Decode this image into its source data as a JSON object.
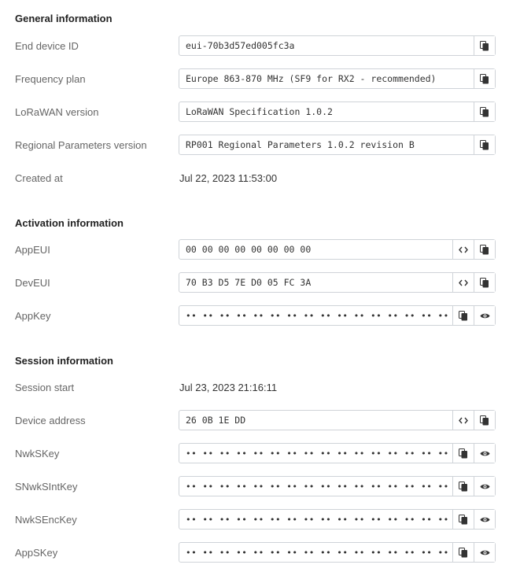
{
  "general": {
    "title": "General information",
    "end_device_id": {
      "label": "End device ID",
      "value": "eui-70b3d57ed005fc3a"
    },
    "frequency_plan": {
      "label": "Frequency plan",
      "value": "Europe 863-870 MHz (SF9 for RX2 - recommended)"
    },
    "lorawan_version": {
      "label": "LoRaWAN version",
      "value": "LoRaWAN Specification 1.0.2"
    },
    "regional_params": {
      "label": "Regional Parameters version",
      "value": "RP001 Regional Parameters 1.0.2 revision B"
    },
    "created_at": {
      "label": "Created at",
      "value": "Jul 22, 2023 11:53:00"
    }
  },
  "activation": {
    "title": "Activation information",
    "app_eui": {
      "label": "AppEUI",
      "value": "00 00 00 00 00 00 00 00"
    },
    "dev_eui": {
      "label": "DevEUI",
      "value": "70 B3 D5 7E D0 05 FC 3A"
    },
    "app_key": {
      "label": "AppKey",
      "value": "•• •• •• •• •• •• •• •• •• •• •• •• •• •• •• ••"
    }
  },
  "session": {
    "title": "Session information",
    "session_start": {
      "label": "Session start",
      "value": "Jul 23, 2023 21:16:11"
    },
    "device_address": {
      "label": "Device address",
      "value": "26 0B 1E DD"
    },
    "nwk_s_key": {
      "label": "NwkSKey",
      "value": "•• •• •• •• •• •• •• •• •• •• •• •• •• •• •• ••"
    },
    "s_nwk_s_int_key": {
      "label": "SNwkSIntKey",
      "value": "•• •• •• •• •• •• •• •• •• •• •• •• •• •• •• ••"
    },
    "nwk_s_enc_key": {
      "label": "NwkSEncKey",
      "value": "•• •• •• •• •• •• •• •• •• •• •• •• •• •• •• ••"
    },
    "app_s_key": {
      "label": "AppSKey",
      "value": "•• •• •• •• •• •• •• •• •• •• •• •• •• •• •• ••"
    }
  },
  "icons": {
    "copy": "copy-icon",
    "toggle_format": "code-brackets-icon",
    "show": "eye-icon"
  }
}
